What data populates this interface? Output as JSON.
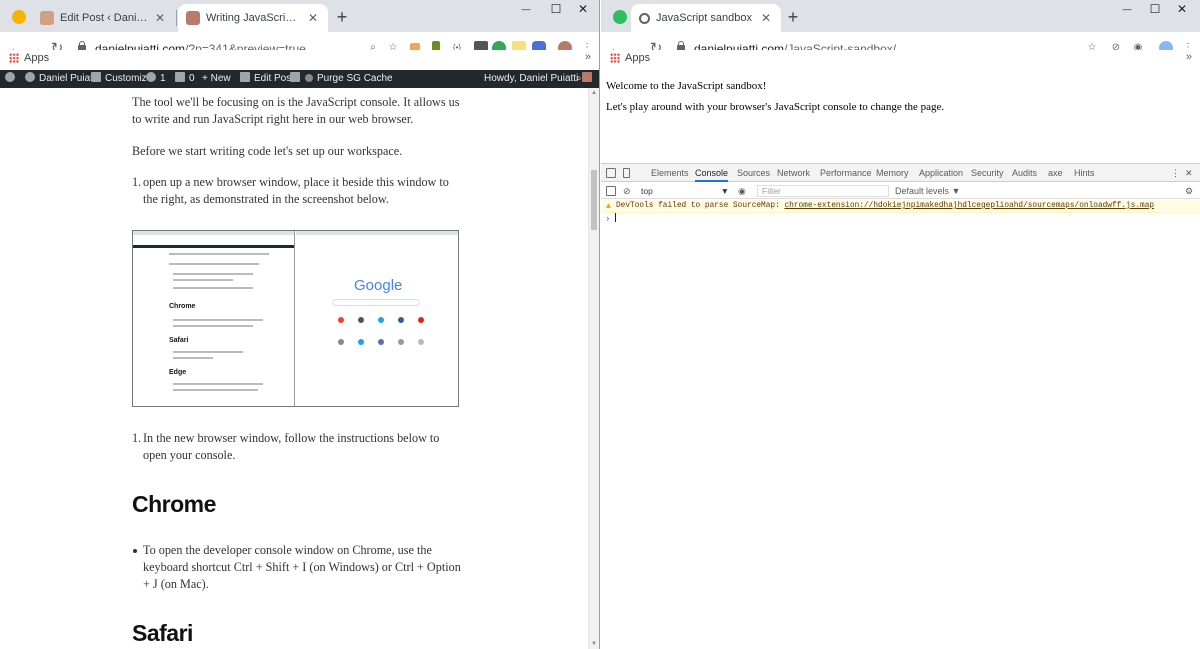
{
  "left_window": {
    "tabs": [
      {
        "title": "Edit Post ‹ Daniel Puiatti — Word",
        "close": "✕"
      },
      {
        "title": "Writing JavaScript code in your w",
        "close": "✕"
      }
    ],
    "new_tab": "+",
    "window_controls": {
      "minimize": "—",
      "maximize": "☐",
      "close": "✕"
    },
    "address": {
      "host": "danielpuiatti.com",
      "path": "/?p=341&preview=true"
    },
    "bookmarks": {
      "apps": "Apps",
      "more": "»"
    },
    "admin_bar": {
      "site": "Daniel Puiatti",
      "customize": "Customize",
      "updates": "1",
      "comments": "0",
      "new": "New",
      "edit_post": "Edit Post",
      "purge": "Purge SG Cache",
      "howdy": "Howdy, Daniel Puiatti"
    },
    "post": {
      "p1": "The tool we'll be focusing on is the JavaScript console. It allows us to write and run JavaScript right here in our web browser.",
      "p2": "Before we start writing code let's set up our workspace.",
      "step1_num": "1.",
      "step1": "open up a new browser window, place it beside this window to the right, as demonstrated in the screenshot below.",
      "step2_num": "1.",
      "step2": "In the new browser window, follow the instructions below to open your console.",
      "h_chrome": "Chrome",
      "chrome_bullet": "To open the developer console window on Chrome, use the keyboard shortcut Ctrl + Shift + I (on Windows) or Ctrl + Option + J (on Mac).",
      "h_safari": "Safari"
    },
    "screenshot": {
      "headings": [
        "Chrome",
        "Safari",
        "Edge"
      ],
      "google": "Google"
    }
  },
  "right_window": {
    "tab": {
      "title": "JavaScript sandbox",
      "close": "✕"
    },
    "new_tab": "+",
    "window_controls": {
      "minimize": "—",
      "maximize": "☐",
      "close": "✕"
    },
    "address": {
      "host": "danielpuiatti.com",
      "path": "/JavaScript-sandbox/"
    },
    "bookmarks": {
      "apps": "Apps",
      "more": "»"
    },
    "page": {
      "line1": "Welcome to the JavaScript sandbox!",
      "line2": "Let's play around with your browser's JavaScript console to change the page."
    },
    "devtools": {
      "tabs": [
        "Elements",
        "Console",
        "Sources",
        "Network",
        "Performance",
        "Memory",
        "Application",
        "Security",
        "Audits",
        "axe",
        "Hints"
      ],
      "active_tab": "Console",
      "context": "top",
      "filter_placeholder": "Filter",
      "levels": "Default levels ▼",
      "warning_text": "DevTools failed to parse SourceMap: ",
      "warning_link": "chrome-extension://hdokiejnpimakedhajhdlcegeplioahd/sourcemaps/onloadwff.js.map",
      "prompt": "›"
    }
  },
  "colors": {
    "tabstrip": "#dee1e6",
    "wp_admin_bar": "#23282d",
    "devtools_accent": "#1a73e8",
    "warning_bg": "#fffbe5"
  }
}
